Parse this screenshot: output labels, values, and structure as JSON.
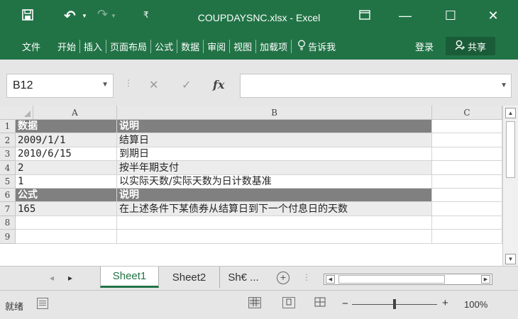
{
  "app": {
    "title": "COUPDAYSNC.xlsx - Excel",
    "quick_access": {
      "save_icon": "save-icon",
      "undo_icon": "undo-icon",
      "redo_icon": "redo-icon"
    },
    "window_controls": {
      "ribbon_display": "ribbon-display-icon",
      "minimize": "—",
      "restore": "☐",
      "close": "✕"
    }
  },
  "ribbon": {
    "tabs": [
      "文件",
      "开始",
      "插入",
      "页面布局",
      "公式",
      "数据",
      "审阅",
      "视图",
      "加载项"
    ],
    "tell_me": "告诉我",
    "login": "登录",
    "share": "共享"
  },
  "formula_bar": {
    "name_box": "B12",
    "cancel": "✕",
    "enter": "✓",
    "fx": "fx",
    "formula": ""
  },
  "grid": {
    "columns": [
      "A",
      "B",
      "C"
    ],
    "row_numbers": [
      "1",
      "2",
      "3",
      "4",
      "5",
      "6",
      "7",
      "8",
      "9"
    ],
    "rows": [
      {
        "a": "数据",
        "b": "说明",
        "style": "header"
      },
      {
        "a": "2009/1/1",
        "b": "结算日",
        "style": "alt"
      },
      {
        "a": "2010/6/15",
        "b": "到期日",
        "style": "plain"
      },
      {
        "a": "2",
        "b": "按半年期支付",
        "style": "alt"
      },
      {
        "a": "1",
        "b": "以实际天数/实际天数为日计数基准",
        "style": "plain"
      },
      {
        "a": "公式",
        "b": "说明",
        "style": "header"
      },
      {
        "a": "165",
        "b": "在上述条件下某债券从结算日到下一个付息日的天数",
        "style": "alt"
      },
      {
        "a": "",
        "b": "",
        "style": "plain"
      },
      {
        "a": "",
        "b": "",
        "style": "plain"
      }
    ]
  },
  "sheets": {
    "tabs": [
      "Sheet1",
      "Sheet2",
      "Sh€ ..."
    ],
    "active": "Sheet1",
    "add": "⊕"
  },
  "status": {
    "ready": "就绪",
    "zoom": "100%",
    "zoom_fraction": 0.5
  },
  "colors": {
    "brand": "#217346",
    "header_fill": "#808080",
    "alt_fill": "#ececec"
  }
}
